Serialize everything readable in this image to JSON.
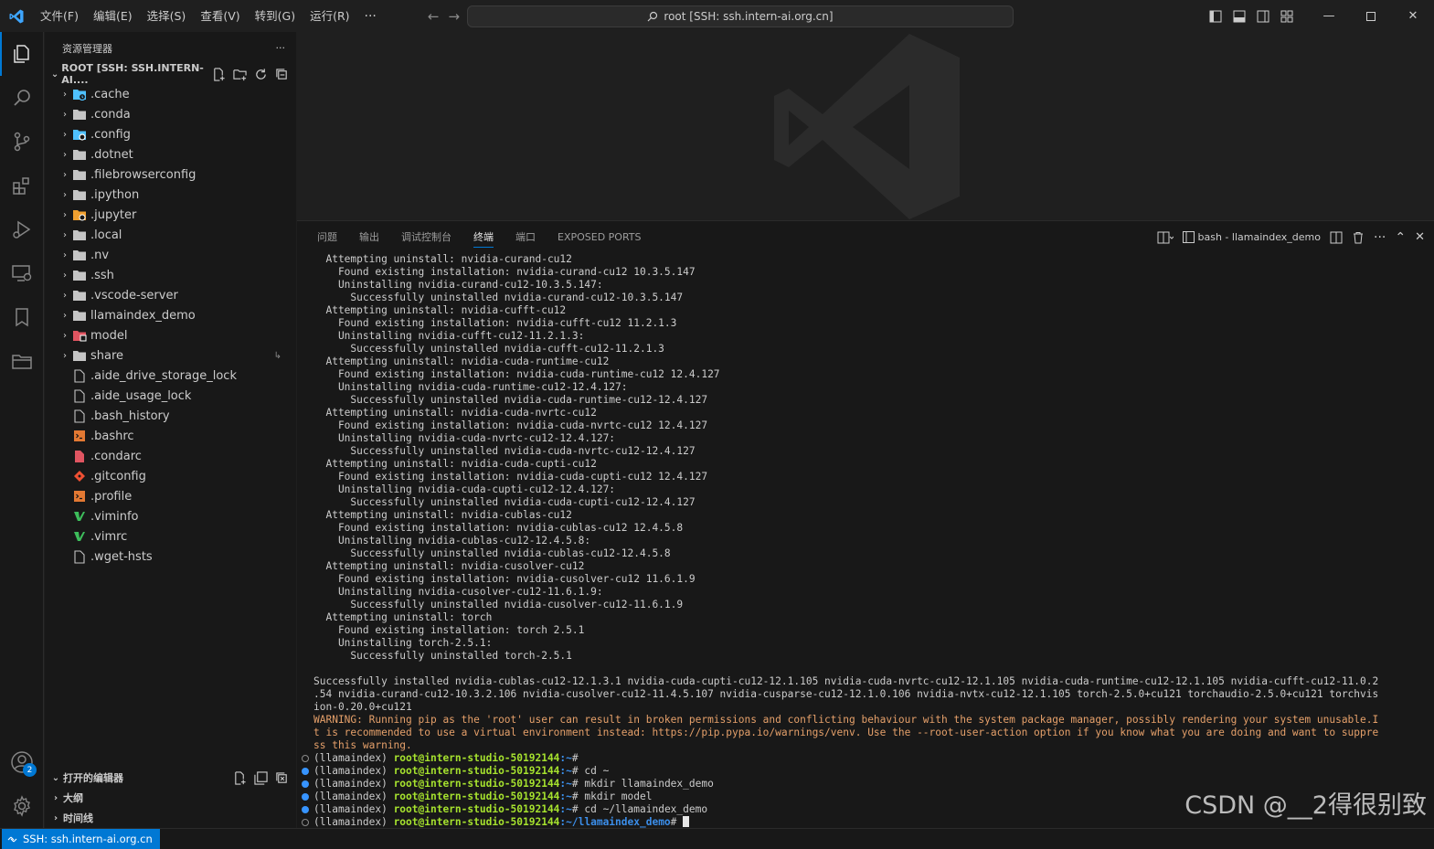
{
  "menu": [
    "文件(F)",
    "编辑(E)",
    "选择(S)",
    "查看(V)",
    "转到(G)",
    "运行(R)"
  ],
  "menu_more": "···",
  "command_center": "root [SSH: ssh.intern-ai.org.cn]",
  "sidebar": {
    "title": "资源管理器",
    "more": "···",
    "root_label": "ROOT [SSH: SSH.INTERN-AI....",
    "items": [
      {
        "name": ".cache",
        "kind": "folder",
        "icon": "cache-folder-icon",
        "color": "#4fc1ff"
      },
      {
        "name": ".conda",
        "kind": "folder",
        "icon": "folder-icon",
        "color": "#c5c5c5"
      },
      {
        "name": ".config",
        "kind": "folder",
        "icon": "config-folder-icon",
        "color": "#4fc1ff"
      },
      {
        "name": ".dotnet",
        "kind": "folder",
        "icon": "folder-icon",
        "color": "#c5c5c5"
      },
      {
        "name": ".filebrowserconfig",
        "kind": "folder",
        "icon": "folder-icon",
        "color": "#c5c5c5"
      },
      {
        "name": ".ipython",
        "kind": "folder",
        "icon": "folder-icon",
        "color": "#c5c5c5"
      },
      {
        "name": ".jupyter",
        "kind": "folder",
        "icon": "jupyter-folder-icon",
        "color": "#f0a030"
      },
      {
        "name": ".local",
        "kind": "folder",
        "icon": "folder-icon",
        "color": "#c5c5c5"
      },
      {
        "name": ".nv",
        "kind": "folder",
        "icon": "folder-icon",
        "color": "#c5c5c5"
      },
      {
        "name": ".ssh",
        "kind": "folder",
        "icon": "folder-icon",
        "color": "#c5c5c5"
      },
      {
        "name": ".vscode-server",
        "kind": "folder",
        "icon": "folder-icon",
        "color": "#c5c5c5"
      },
      {
        "name": "llamaindex_demo",
        "kind": "folder",
        "icon": "folder-icon",
        "color": "#c5c5c5"
      },
      {
        "name": "model",
        "kind": "folder",
        "icon": "model-folder-icon",
        "color": "#e05561"
      },
      {
        "name": "share",
        "kind": "folder",
        "icon": "folder-icon",
        "color": "#c5c5c5",
        "symlink": true
      },
      {
        "name": ".aide_drive_storage_lock",
        "kind": "file",
        "icon": "file-icon",
        "color": "#c5c5c5"
      },
      {
        "name": ".aide_usage_lock",
        "kind": "file",
        "icon": "file-icon",
        "color": "#c5c5c5"
      },
      {
        "name": ".bash_history",
        "kind": "file",
        "icon": "file-icon",
        "color": "#c5c5c5"
      },
      {
        "name": ".bashrc",
        "kind": "file",
        "icon": "shell-file-icon",
        "color": "#e37933"
      },
      {
        "name": ".condarc",
        "kind": "file",
        "icon": "conda-file-icon",
        "color": "#e05561"
      },
      {
        "name": ".gitconfig",
        "kind": "file",
        "icon": "git-file-icon",
        "color": "#f05033"
      },
      {
        "name": ".profile",
        "kind": "file",
        "icon": "shell-file-icon",
        "color": "#e37933"
      },
      {
        "name": ".viminfo",
        "kind": "file",
        "icon": "vim-file-icon",
        "color": "#3dbd5b"
      },
      {
        "name": ".vimrc",
        "kind": "file",
        "icon": "vim-file-icon",
        "color": "#3dbd5b"
      },
      {
        "name": ".wget-hsts",
        "kind": "file",
        "icon": "file-icon",
        "color": "#c5c5c5"
      }
    ],
    "open_editors": "打开的编辑器",
    "outline": "大纲",
    "timeline": "时间线"
  },
  "activity": {
    "accounts_badge": "2"
  },
  "panel": {
    "tabs": [
      "问题",
      "输出",
      "调试控制台",
      "终端",
      "端口",
      "EXPOSED PORTS"
    ],
    "active_tab": "终端",
    "terminal_name": "bash - llamaindex_demo"
  },
  "terminal": {
    "log": [
      "  Attempting uninstall: nvidia-curand-cu12",
      "    Found existing installation: nvidia-curand-cu12 10.3.5.147",
      "    Uninstalling nvidia-curand-cu12-10.3.5.147:",
      "      Successfully uninstalled nvidia-curand-cu12-10.3.5.147",
      "  Attempting uninstall: nvidia-cufft-cu12",
      "    Found existing installation: nvidia-cufft-cu12 11.2.1.3",
      "    Uninstalling nvidia-cufft-cu12-11.2.1.3:",
      "      Successfully uninstalled nvidia-cufft-cu12-11.2.1.3",
      "  Attempting uninstall: nvidia-cuda-runtime-cu12",
      "    Found existing installation: nvidia-cuda-runtime-cu12 12.4.127",
      "    Uninstalling nvidia-cuda-runtime-cu12-12.4.127:",
      "      Successfully uninstalled nvidia-cuda-runtime-cu12-12.4.127",
      "  Attempting uninstall: nvidia-cuda-nvrtc-cu12",
      "    Found existing installation: nvidia-cuda-nvrtc-cu12 12.4.127",
      "    Uninstalling nvidia-cuda-nvrtc-cu12-12.4.127:",
      "      Successfully uninstalled nvidia-cuda-nvrtc-cu12-12.4.127",
      "  Attempting uninstall: nvidia-cuda-cupti-cu12",
      "    Found existing installation: nvidia-cuda-cupti-cu12 12.4.127",
      "    Uninstalling nvidia-cuda-cupti-cu12-12.4.127:",
      "      Successfully uninstalled nvidia-cuda-cupti-cu12-12.4.127",
      "  Attempting uninstall: nvidia-cublas-cu12",
      "    Found existing installation: nvidia-cublas-cu12 12.4.5.8",
      "    Uninstalling nvidia-cublas-cu12-12.4.5.8:",
      "      Successfully uninstalled nvidia-cublas-cu12-12.4.5.8",
      "  Attempting uninstall: nvidia-cusolver-cu12",
      "    Found existing installation: nvidia-cusolver-cu12 11.6.1.9",
      "    Uninstalling nvidia-cusolver-cu12-11.6.1.9:",
      "      Successfully uninstalled nvidia-cusolver-cu12-11.6.1.9",
      "  Attempting uninstall: torch",
      "    Found existing installation: torch 2.5.1",
      "    Uninstalling torch-2.5.1:",
      "      Successfully uninstalled torch-2.5.1",
      "",
      "Successfully installed nvidia-cublas-cu12-12.1.3.1 nvidia-cuda-cupti-cu12-12.1.105 nvidia-cuda-nvrtc-cu12-12.1.105 nvidia-cuda-runtime-cu12-12.1.105 nvidia-cufft-cu12-11.0.2",
      ".54 nvidia-curand-cu12-10.3.2.106 nvidia-cusolver-cu12-11.4.5.107 nvidia-cusparse-cu12-12.1.0.106 nvidia-nvtx-cu12-12.1.105 torch-2.5.0+cu121 torchaudio-2.5.0+cu121 torchvis",
      "ion-0.20.0+cu121"
    ],
    "warning": [
      "WARNING: Running pip as the 'root' user can result in broken permissions and conflicting behaviour with the system package manager, possibly rendering your system unusable.I",
      "t is recommended to use a virtual environment instead: https://pip.pypa.io/warnings/venv. Use the --root-user-action option if you know what you are doing and want to suppre",
      "ss this warning."
    ],
    "prompts": [
      {
        "env": "(llamaindex) ",
        "user": "root@intern-studio-50192144",
        "path": ":~",
        "cmd": "# ",
        "dot": "hollow"
      },
      {
        "env": "(llamaindex) ",
        "user": "root@intern-studio-50192144",
        "path": ":~",
        "cmd": "# cd ~",
        "dot": "blue"
      },
      {
        "env": "(llamaindex) ",
        "user": "root@intern-studio-50192144",
        "path": ":~",
        "cmd": "# mkdir llamaindex_demo",
        "dot": "blue"
      },
      {
        "env": "(llamaindex) ",
        "user": "root@intern-studio-50192144",
        "path": ":~",
        "cmd": "# mkdir model",
        "dot": "blue"
      },
      {
        "env": "(llamaindex) ",
        "user": "root@intern-studio-50192144",
        "path": ":~",
        "cmd": "# cd ~/llamaindex_demo",
        "dot": "blue"
      },
      {
        "env": "(llamaindex) ",
        "user": "root@intern-studio-50192144",
        "path": ":~/llamaindex_demo",
        "cmd": "# ",
        "dot": "hollow",
        "current": true
      }
    ]
  },
  "watermark": "CSDN @__2得很别致",
  "statusbar": {
    "remote": "SSH: ssh.intern-ai.org.cn"
  },
  "colors": {
    "accent": "#0078d4",
    "prompt_user": "#a6e22e",
    "prompt_path": "#3b8eea",
    "warning": "#e5a06a"
  }
}
